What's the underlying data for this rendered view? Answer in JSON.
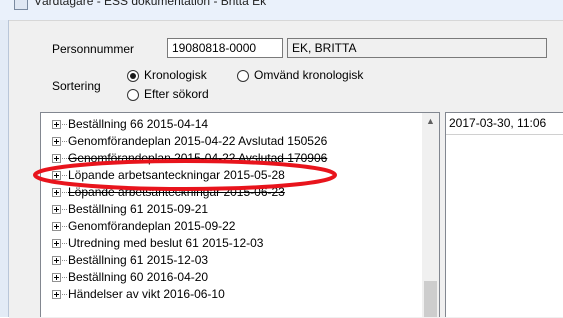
{
  "window": {
    "title": "Vårdtagare - ESS dokumentation - Britta Ek"
  },
  "person": {
    "personnummer_label": "Personnummer",
    "personnummer_value": "19080818-0000",
    "name_value": "EK, BRITTA"
  },
  "sorting": {
    "label": "Sortering",
    "options": [
      {
        "label": "Kronologisk",
        "selected": true
      },
      {
        "label": "Omvänd kronologisk",
        "selected": false
      },
      {
        "label": "Efter sökord",
        "selected": false
      }
    ]
  },
  "tree": {
    "items": [
      {
        "label": "Beställning 66  2015-04-14",
        "strikethrough": false
      },
      {
        "label": "Genomförandeplan  2015-04-22 Avslutad 150526",
        "strikethrough": false
      },
      {
        "label": "Genomförandeplan  2015-04-22 Avslutad 170906",
        "strikethrough": true
      },
      {
        "label": "Löpande arbetsanteckningar  2015-05-28",
        "strikethrough": false,
        "highlighted": true
      },
      {
        "label": "Löpande arbetsanteckningar  2015-06-23",
        "strikethrough": true
      },
      {
        "label": "Beställning 61  2015-09-21",
        "strikethrough": false
      },
      {
        "label": "Genomförandeplan  2015-09-22",
        "strikethrough": false
      },
      {
        "label": "Utredning med beslut 61  2015-12-03",
        "strikethrough": false
      },
      {
        "label": "Beställning 61  2015-12-03",
        "strikethrough": false
      },
      {
        "label": "Beställning 60  2016-04-20",
        "strikethrough": false
      },
      {
        "label": "Händelser av vikt  2016-06-10",
        "strikethrough": false
      }
    ]
  },
  "detail": {
    "timestamp": "2017-03-30, 11:06"
  },
  "colors": {
    "annotation_ellipse": "#e8141c",
    "window_frame": "#e3ebf6",
    "panel_background": "#f0f0f0"
  }
}
